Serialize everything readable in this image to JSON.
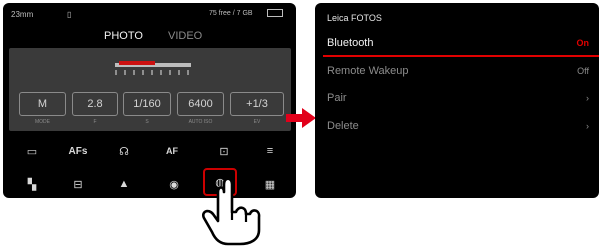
{
  "camera_screen": {
    "status": {
      "left": "23mm",
      "storage": "75 free / 7 GB"
    },
    "tabs": [
      {
        "label": "PHOTO",
        "active": true
      },
      {
        "label": "VIDEO",
        "active": false
      }
    ],
    "settings": [
      {
        "value": "M",
        "caption": "MODE"
      },
      {
        "value": "2.8",
        "caption": "F"
      },
      {
        "value": "1/160",
        "caption": "S"
      },
      {
        "value": "6400",
        "caption": "AUTO ISO"
      },
      {
        "value": "+1/3",
        "caption": "EV"
      }
    ],
    "row1_icons": [
      {
        "name": "drive-mode-icon",
        "glyph": "▭"
      },
      {
        "name": "focus-mode-icon",
        "glyph": "AFs"
      },
      {
        "name": "face-detection-icon",
        "glyph": "☊"
      },
      {
        "name": "exposure-metering-icon",
        "glyph": "AF"
      },
      {
        "name": "save-icon",
        "glyph": "⊡"
      },
      {
        "name": "flash-icon",
        "glyph": "≡"
      }
    ],
    "row2_icons": [
      {
        "name": "white-balance-icon",
        "glyph": "▚"
      },
      {
        "name": "file-format-icon",
        "glyph": "⊟"
      },
      {
        "name": "timer-icon",
        "glyph": "▲"
      },
      {
        "name": "stabilization-icon",
        "glyph": "◉"
      },
      {
        "name": "connectivity-icon",
        "glyph": "◍"
      },
      {
        "name": "menu-icon",
        "glyph": "▦"
      }
    ],
    "highlight_color": "#cc0000"
  },
  "menu_screen": {
    "title": "Leica FOTOS",
    "items": [
      {
        "label": "Bluetooth",
        "value": "On",
        "active": true
      },
      {
        "label": "Remote Wakeup",
        "value": "Off",
        "active": false
      },
      {
        "label": "Pair",
        "value": "›",
        "active": false
      },
      {
        "label": "Delete",
        "value": "›",
        "active": false
      }
    ],
    "accent_color": "#e20000"
  }
}
